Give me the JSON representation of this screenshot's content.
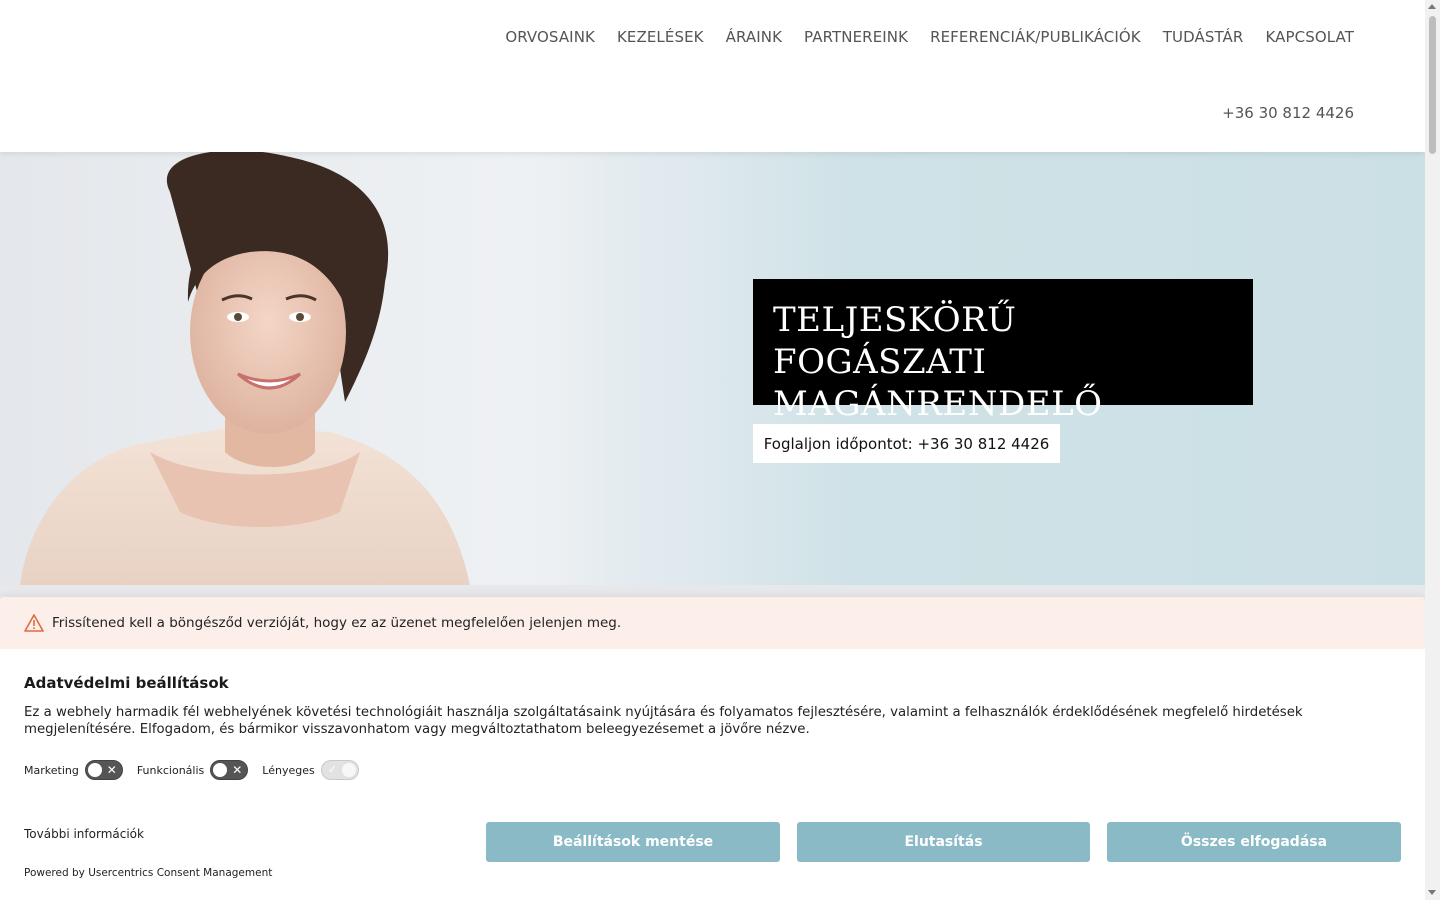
{
  "header": {
    "nav": [
      {
        "label": "ORVOSAINK"
      },
      {
        "label": "KEZELÉSEK"
      },
      {
        "label": "ÁRAINK"
      },
      {
        "label": "PARTNEREINK"
      },
      {
        "label": "REFERENCIÁK/PUBLIKÁCIÓK"
      },
      {
        "label": "TUDÁSTÁR"
      },
      {
        "label": "KAPCSOLAT"
      }
    ],
    "phone": "+36 30 812 4426"
  },
  "hero": {
    "title_line1": "TELJESKÖRŰ FOGÁSZATI",
    "title_line2": "MAGÁNRENDELŐ",
    "cta": "Foglaljon időpontot: +36 30 812 4426"
  },
  "consent": {
    "warning": "Frissítened kell a böngésződ verzióját, hogy ez az üzenet megfelelően jelenjen meg.",
    "title": "Adatvédelmi beállítások",
    "description": "Ez a webhely harmadik fél webhelyének követési technológiáit használja szolgáltatásaink nyújtására és folyamatos fejlesztésére, valamint a felhasználók érdeklődésének megfelelő hirdetések megjelenítésére. Elfogadom, és bármikor visszavonhatom vagy megváltoztathatom beleegyezésemet a jövőre nézve.",
    "toggles": [
      {
        "label": "Marketing",
        "state": "off"
      },
      {
        "label": "Funkcionális",
        "state": "off"
      },
      {
        "label": "Lényeges",
        "state": "on-disabled"
      }
    ],
    "more_info": "További információk",
    "powered_by": "Powered by Usercentrics Consent Management",
    "buttons": {
      "save": "Beállítások mentése",
      "deny": "Elutasítás",
      "accept": "Összes elfogadása"
    }
  },
  "colors": {
    "button_bg": "#8bbac7",
    "warning_bg": "#fcefea",
    "hero_right_bg": "#cbe0e5",
    "title_box_bg": "#000000"
  }
}
